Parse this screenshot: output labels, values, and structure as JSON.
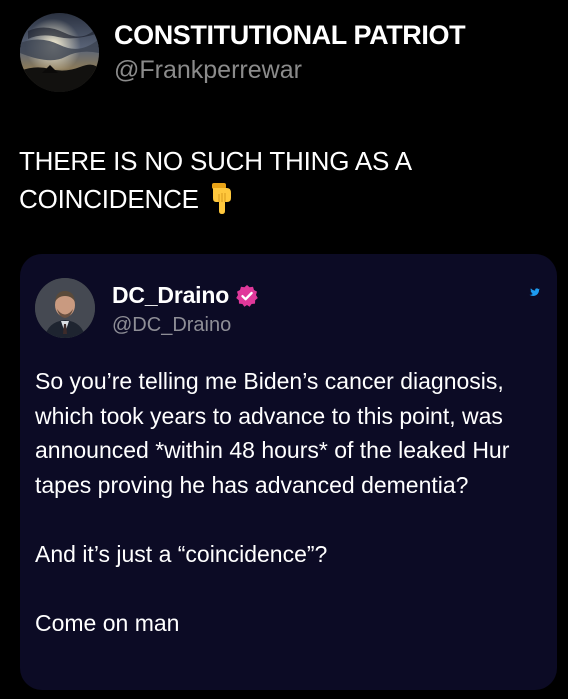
{
  "post": {
    "author": {
      "display_name": "CONSTITUTIONAL PATRIOT",
      "handle": "@Frankperrewar",
      "avatar": "sunset-clouds-avatar"
    },
    "text": "THERE IS NO SUCH THING AS A COINCIDENCE",
    "emoji": "backhand-index-pointing-down"
  },
  "quoted_post": {
    "author": {
      "display_name": "DC_Draino",
      "handle": "@DC_Draino",
      "verified": true,
      "avatar": "man-in-suit-avatar"
    },
    "paragraphs": [
      "So you’re telling me Biden’s cancer diagnosis, which took years to advance to this point, was announced *within 48 hours* of the leaked Hur tapes proving he has advanced dementia?",
      "And it’s just a “coincidence”?",
      "Come on man"
    ],
    "platform_icon": "twitter-bird-icon"
  },
  "colors": {
    "background": "#000000",
    "card_background": "#0c0b25",
    "handle_gray": "#8b8b8b",
    "verified_pink": "#e0389a",
    "twitter_blue": "#1d9bf0"
  }
}
